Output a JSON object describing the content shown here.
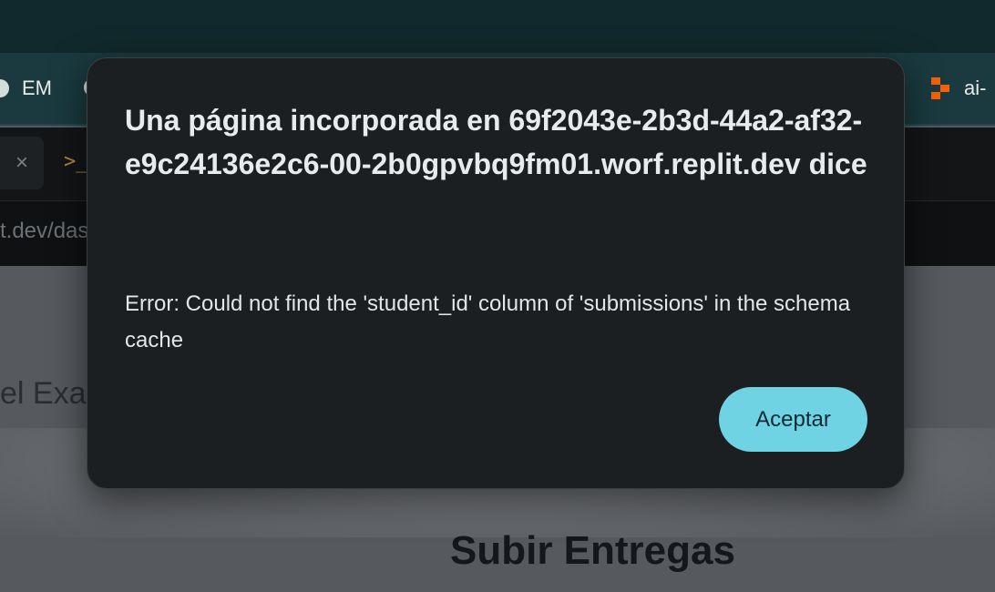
{
  "bookmarks": {
    "items": [
      {
        "label": "EM",
        "icon": "globe-icon"
      },
      {
        "label": "ai-",
        "icon": "replit-logo-icon"
      }
    ]
  },
  "tabbar": {
    "close_glyph": "×",
    "terminal_glyph": ">_"
  },
  "urlbar": {
    "url_fragment": "t.dev/das"
  },
  "page": {
    "side_text": "el Exa",
    "heading": "Subir Entregas"
  },
  "dialog": {
    "title": "Una página incorporada en 69f2043e-2b3d-44a2-af32-e9c24136e2c6-00-2b0gpvbq9fm01.worf.replit.dev dice",
    "message": "Error: Could not find the 'student_id' column of 'submissions' in the schema cache",
    "ok_label": "Aceptar"
  },
  "colors": {
    "accent": "#6fd3e3",
    "dialog_bg": "#1b1f21",
    "replit_orange": "#f26207"
  }
}
